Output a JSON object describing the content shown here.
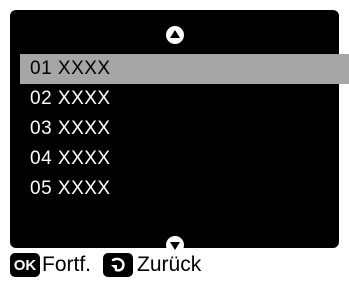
{
  "menu": {
    "items": [
      {
        "label": "01 XXXX",
        "selected": true
      },
      {
        "label": "02 XXXX",
        "selected": false
      },
      {
        "label": "03 XXXX",
        "selected": false
      },
      {
        "label": "04 XXXX",
        "selected": false
      },
      {
        "label": "05 XXXX",
        "selected": false
      }
    ]
  },
  "footer": {
    "ok_icon_label": "OK",
    "continue_label": "Fortf.",
    "back_label": "Zurück"
  },
  "colors": {
    "lcd_background": "#000000",
    "selected_row": "#a6a6a6",
    "text": "#ffffff"
  },
  "icons": {
    "scroll_up": "up-arrow-icon",
    "scroll_down": "down-arrow-icon",
    "back": "back-arrow-icon"
  }
}
